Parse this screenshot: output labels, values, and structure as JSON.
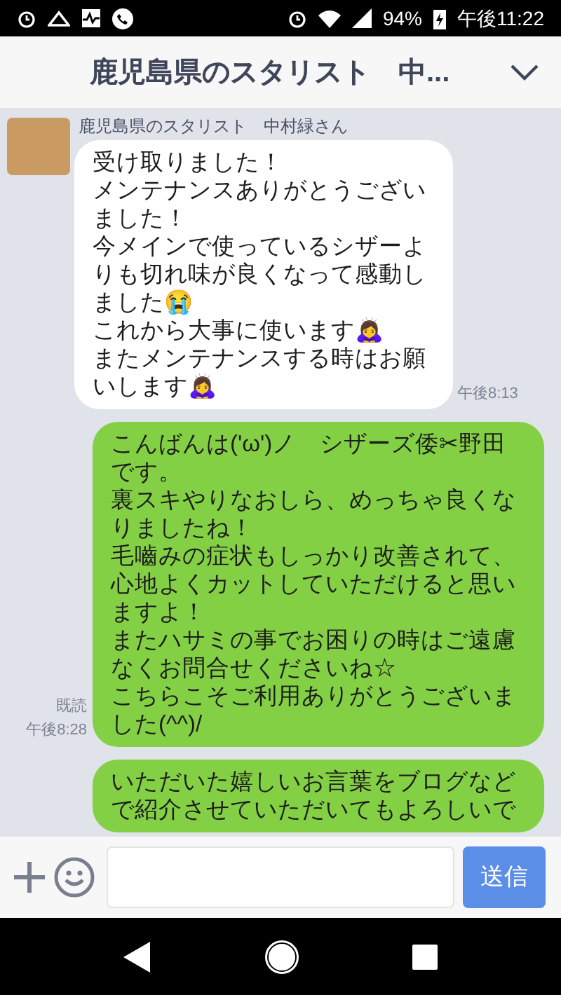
{
  "status_bar": {
    "battery": "94%",
    "time": "午後11:22"
  },
  "header": {
    "title": "鹿児島県のスタリスト　中..."
  },
  "messages": [
    {
      "kind": "incoming",
      "sender": "鹿児島県のスタリスト　中村緑さん",
      "lines": [
        "受け取りました！",
        "メンテナンスありがとうございました！",
        "今メインで使っているシザーよりも切れ味が良くなって感動しました😭",
        "これから大事に使います🙇‍♀️",
        "またメンテナンスする時はお願いします🙇‍♀️"
      ],
      "time": "午後8:13"
    },
    {
      "kind": "outgoing",
      "read": "既読",
      "lines": [
        "こんばんは('ω')ノ　シザーズ倭✂野田です。",
        "裏スキやりなおしら、めっちゃ良くなりましたね！",
        "毛嚙みの症状もしっかり改善されて、心地よくカットしていただけると思いますよ！",
        "またハサミの事でお困りの時はご遠慮なくお問合せくださいね☆",
        "こちらこそご利用ありがとうございました(^^)/"
      ],
      "time": "午後8:28"
    },
    {
      "kind": "outgoing",
      "lines": [
        "いただいた嬉しいお言葉をブログなどで紹介させていただいてもよろしいで"
      ]
    }
  ],
  "input": {
    "send": "送信"
  }
}
